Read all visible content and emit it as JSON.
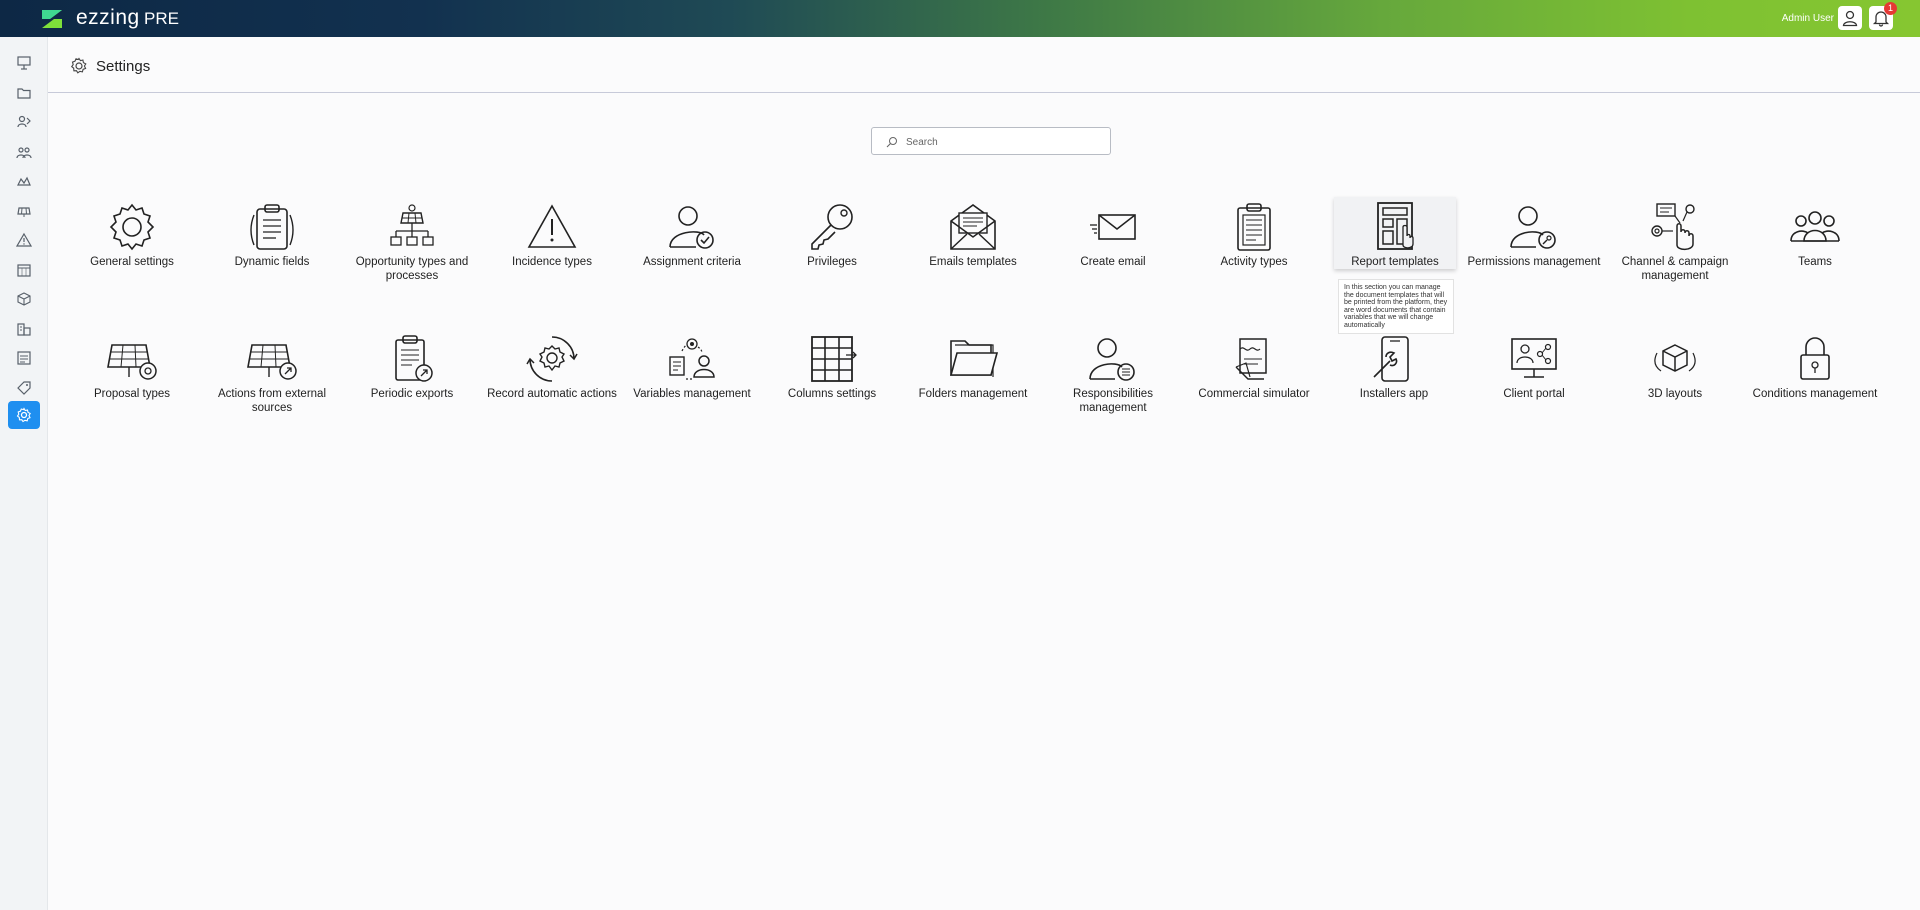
{
  "topbar": {
    "brand": "ezzing",
    "environment": "PRE",
    "user_name": "Admin User",
    "notifications_count": "1",
    "logo_icon": "ezzing-logo-icon",
    "colors": {
      "gradient_start": "#0d2845",
      "gradient_end": "#86c631",
      "badge": "#e53935"
    }
  },
  "sidebar": {
    "items": [
      {
        "icon": "dashboard-icon"
      },
      {
        "icon": "folder-icon"
      },
      {
        "icon": "leads-icon"
      },
      {
        "icon": "opportunities-icon"
      },
      {
        "icon": "installations-icon"
      },
      {
        "icon": "solar-panel-icon"
      },
      {
        "icon": "warning-icon"
      },
      {
        "icon": "calendar-icon"
      },
      {
        "icon": "box-icon"
      },
      {
        "icon": "buildings-icon"
      },
      {
        "icon": "reports-icon"
      },
      {
        "icon": "tag-icon"
      },
      {
        "icon": "settings-icon",
        "active": true
      }
    ],
    "active_color": "#1f8ff0"
  },
  "header": {
    "title": "Settings"
  },
  "search": {
    "placeholder": "Search",
    "value": ""
  },
  "tiles_row1": [
    {
      "label": "General settings",
      "icon": "gear-icon"
    },
    {
      "label": "Dynamic fields",
      "icon": "clipboard-list-icon"
    },
    {
      "label": "Opportunity types and processes",
      "icon": "solar-hierarchy-icon"
    },
    {
      "label": "Incidence types",
      "icon": "warning-triangle-icon"
    },
    {
      "label": "Assignment criteria",
      "icon": "user-check-icon"
    },
    {
      "label": "Privileges",
      "icon": "key-icon"
    },
    {
      "label": "Emails templates",
      "icon": "envelope-open-icon"
    },
    {
      "label": "Create email",
      "icon": "send-mail-icon"
    },
    {
      "label": "Activity types",
      "icon": "checklist-clipboard-icon"
    },
    {
      "label": "Report templates",
      "icon": "report-template-icon"
    },
    {
      "label": "Permissions management",
      "icon": "user-key-icon"
    },
    {
      "label": "Channel & campaign management",
      "icon": "campaign-click-icon"
    },
    {
      "label": "Teams",
      "icon": "team-icon"
    }
  ],
  "tiles_row2": [
    {
      "label": "Proposal types",
      "icon": "solar-panel-gear-icon"
    },
    {
      "label": "Actions from external sources",
      "icon": "solar-panel-external-icon"
    },
    {
      "label": "Periodic exports",
      "icon": "clipboard-export-icon"
    },
    {
      "label": "Record automatic actions",
      "icon": "gear-cycle-icon"
    },
    {
      "label": "Variables management",
      "icon": "variables-user-icon"
    },
    {
      "label": "Columns settings",
      "icon": "table-columns-icon"
    },
    {
      "label": "Folders management",
      "icon": "folders-icon"
    },
    {
      "label": "Responsibilities management",
      "icon": "user-list-icon"
    },
    {
      "label": "Commercial simulator",
      "icon": "simulator-doc-icon"
    },
    {
      "label": "Installers app",
      "icon": "mobile-tools-icon"
    },
    {
      "label": "Client portal",
      "icon": "monitor-share-icon"
    },
    {
      "label": "3D layouts",
      "icon": "cube-3d-icon"
    },
    {
      "label": "Conditions management",
      "icon": "lock-icon"
    }
  ],
  "tooltip": {
    "text": "In this section you can manage the document templates that will be printed from the platform, they are word documents that contain variables that we will change automatically"
  }
}
